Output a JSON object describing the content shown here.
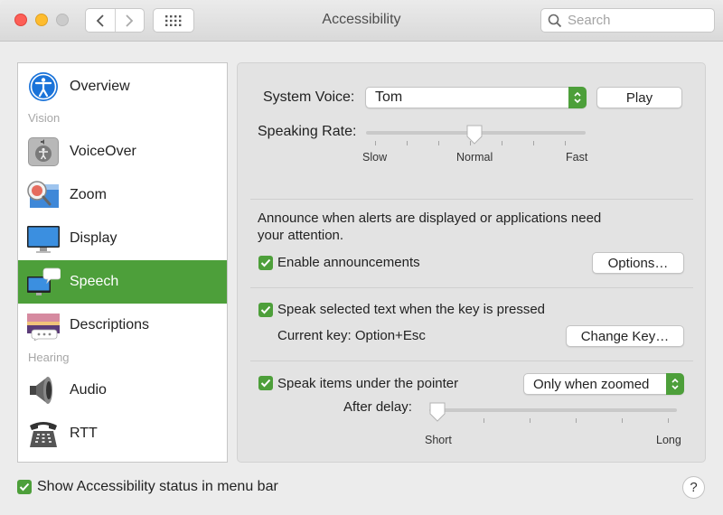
{
  "window": {
    "title": "Accessibility"
  },
  "search": {
    "placeholder": "Search"
  },
  "sidebar": {
    "items": [
      {
        "label": "Overview"
      },
      {
        "label": "VoiceOver"
      },
      {
        "label": "Zoom"
      },
      {
        "label": "Display"
      },
      {
        "label": "Speech"
      },
      {
        "label": "Descriptions"
      },
      {
        "label": "Audio"
      },
      {
        "label": "RTT"
      }
    ],
    "headers": {
      "vision": "Vision",
      "hearing": "Hearing"
    },
    "selected": "Speech"
  },
  "speech": {
    "system_voice_label": "System Voice:",
    "system_voice_value": "Tom",
    "play_label": "Play",
    "speaking_rate_label": "Speaking Rate:",
    "rate_ticks": {
      "slow": "Slow",
      "normal": "Normal",
      "fast": "Fast"
    },
    "rate_value": 0.5,
    "announce_text_1": "Announce when alerts are displayed or applications need",
    "announce_text_2": "your attention.",
    "enable_announcements_label": "Enable announcements",
    "enable_announcements_checked": true,
    "options_label": "Options…",
    "speak_selected_label": "Speak selected text when the key is pressed",
    "speak_selected_checked": true,
    "current_key_text": "Current key: Option+Esc",
    "change_key_label": "Change Key…",
    "speak_pointer_label": "Speak items under the pointer",
    "speak_pointer_checked": true,
    "pointer_mode_value": "Only when zoomed",
    "after_delay_label": "After delay:",
    "delay_ticks": {
      "short": "Short",
      "long": "Long"
    },
    "delay_value": 0
  },
  "footer": {
    "menu_bar_status_label": "Show Accessibility status in menu bar",
    "menu_bar_status_checked": true,
    "help_label": "?"
  },
  "colors": {
    "accent": "#4d9f3a",
    "close": "#fd5f57",
    "minimize": "#febc2e"
  }
}
